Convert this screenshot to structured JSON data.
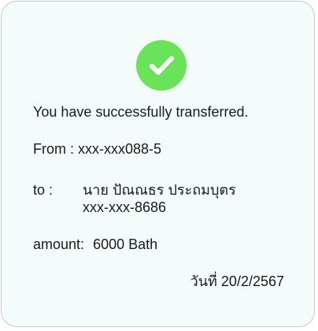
{
  "receipt": {
    "headline": "You have successfully transferred.",
    "from_label": "From :",
    "from_account": "xxx-xxx088-5",
    "to_label": "to :",
    "to_name": "นาย ปัณณธร ประถมบุตร",
    "to_account": "xxx-xxx-8686",
    "amount_label": "amount:",
    "amount_value": "6000 Bath",
    "date_label": "วันที่",
    "date_value": "20/2/2567"
  },
  "icons": {
    "status": "check-icon"
  },
  "colors": {
    "success_green": "#6ae35a",
    "card_background": "#f4fbfb",
    "card_border": "#c9c9c9",
    "text": "#1a1a1a"
  }
}
